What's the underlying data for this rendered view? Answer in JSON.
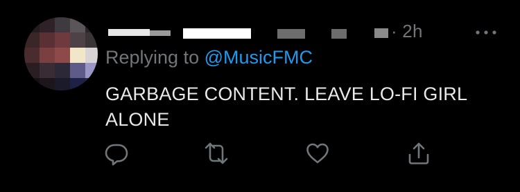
{
  "tweet": {
    "timestamp": "· 2h",
    "reply_prefix": "Replying to",
    "reply_handle": "@MusicFMC",
    "body": "GARBAGE CONTENT. LEAVE LO-FI GIRL ALONE",
    "body_line_1": "GARBAGE CONTENT. LEAVE LO-FI GIRL",
    "body_line_2": "ALONE"
  },
  "icons": {
    "more": "more-icon",
    "reply": "reply-icon",
    "retweet": "retweet-icon",
    "like": "like-icon",
    "share": "share-icon"
  },
  "colors": {
    "background": "#000000",
    "text": "#e7e9ea",
    "muted": "#71767b",
    "link": "#1d9bf0"
  }
}
